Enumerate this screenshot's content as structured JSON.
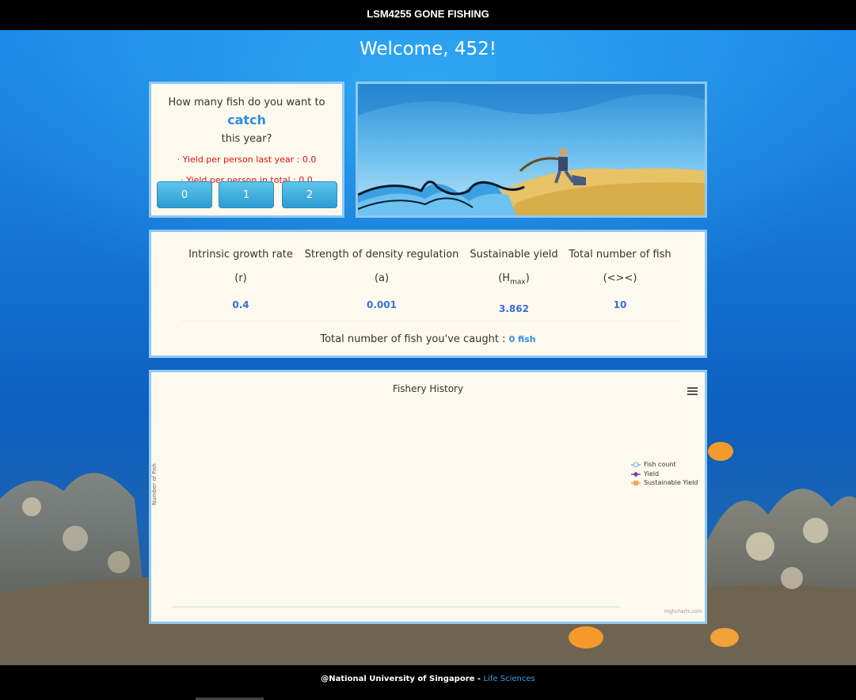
{
  "header": {
    "title": "LSM4255 GONE FISHING"
  },
  "welcome": "Welcome, 452!",
  "catch_panel": {
    "question_pre": "How many fish do you want to ",
    "question_kw": "catch",
    "question_post": "this year?",
    "yield_last_year": "· Yield per person last year : 0.0",
    "yield_total": "· Yield per person in total : 0.0",
    "buttons": [
      "0",
      "1",
      "2"
    ]
  },
  "stats": {
    "columns": [
      {
        "header": "Intrinsic growth rate",
        "symbol": "(r)",
        "value": "0.4"
      },
      {
        "header": "Strength of density regulation",
        "symbol": "(a)",
        "value": "0.001"
      },
      {
        "header": "Sustainable yield",
        "symbol_base": "(H",
        "symbol_sub": "max",
        "symbol_close": ")",
        "value": "3.862"
      },
      {
        "header": "Total number of fish",
        "symbol": "(<><)",
        "value": "10"
      }
    ],
    "caught_label": "Total number of fish you've caught : ",
    "caught_value": "0 fish"
  },
  "chart_data": {
    "type": "line",
    "title": "Fishery History",
    "ylabel": "Number of Fish",
    "xlabel": "",
    "series": [
      {
        "name": "Fish count",
        "values": [],
        "color": "#7cb5ec",
        "marker": "circle"
      },
      {
        "name": "Yield",
        "values": [],
        "color": "#7b3fa0",
        "marker": "diamond"
      },
      {
        "name": "Sustainable Yield",
        "values": [],
        "color": "#f7a35c",
        "marker": "square"
      }
    ],
    "legend": "right",
    "credits": "Highcharts.com"
  },
  "footer": {
    "text": "@National University of Singapore - ",
    "link": "Life Sciences"
  },
  "colors": {
    "accent": "#2c8ee8",
    "panel_bg": "#fdf9ee",
    "panel_border": "#8fc9f1",
    "yield_red": "#dd1111",
    "value_blue": "#3a6ed6"
  }
}
